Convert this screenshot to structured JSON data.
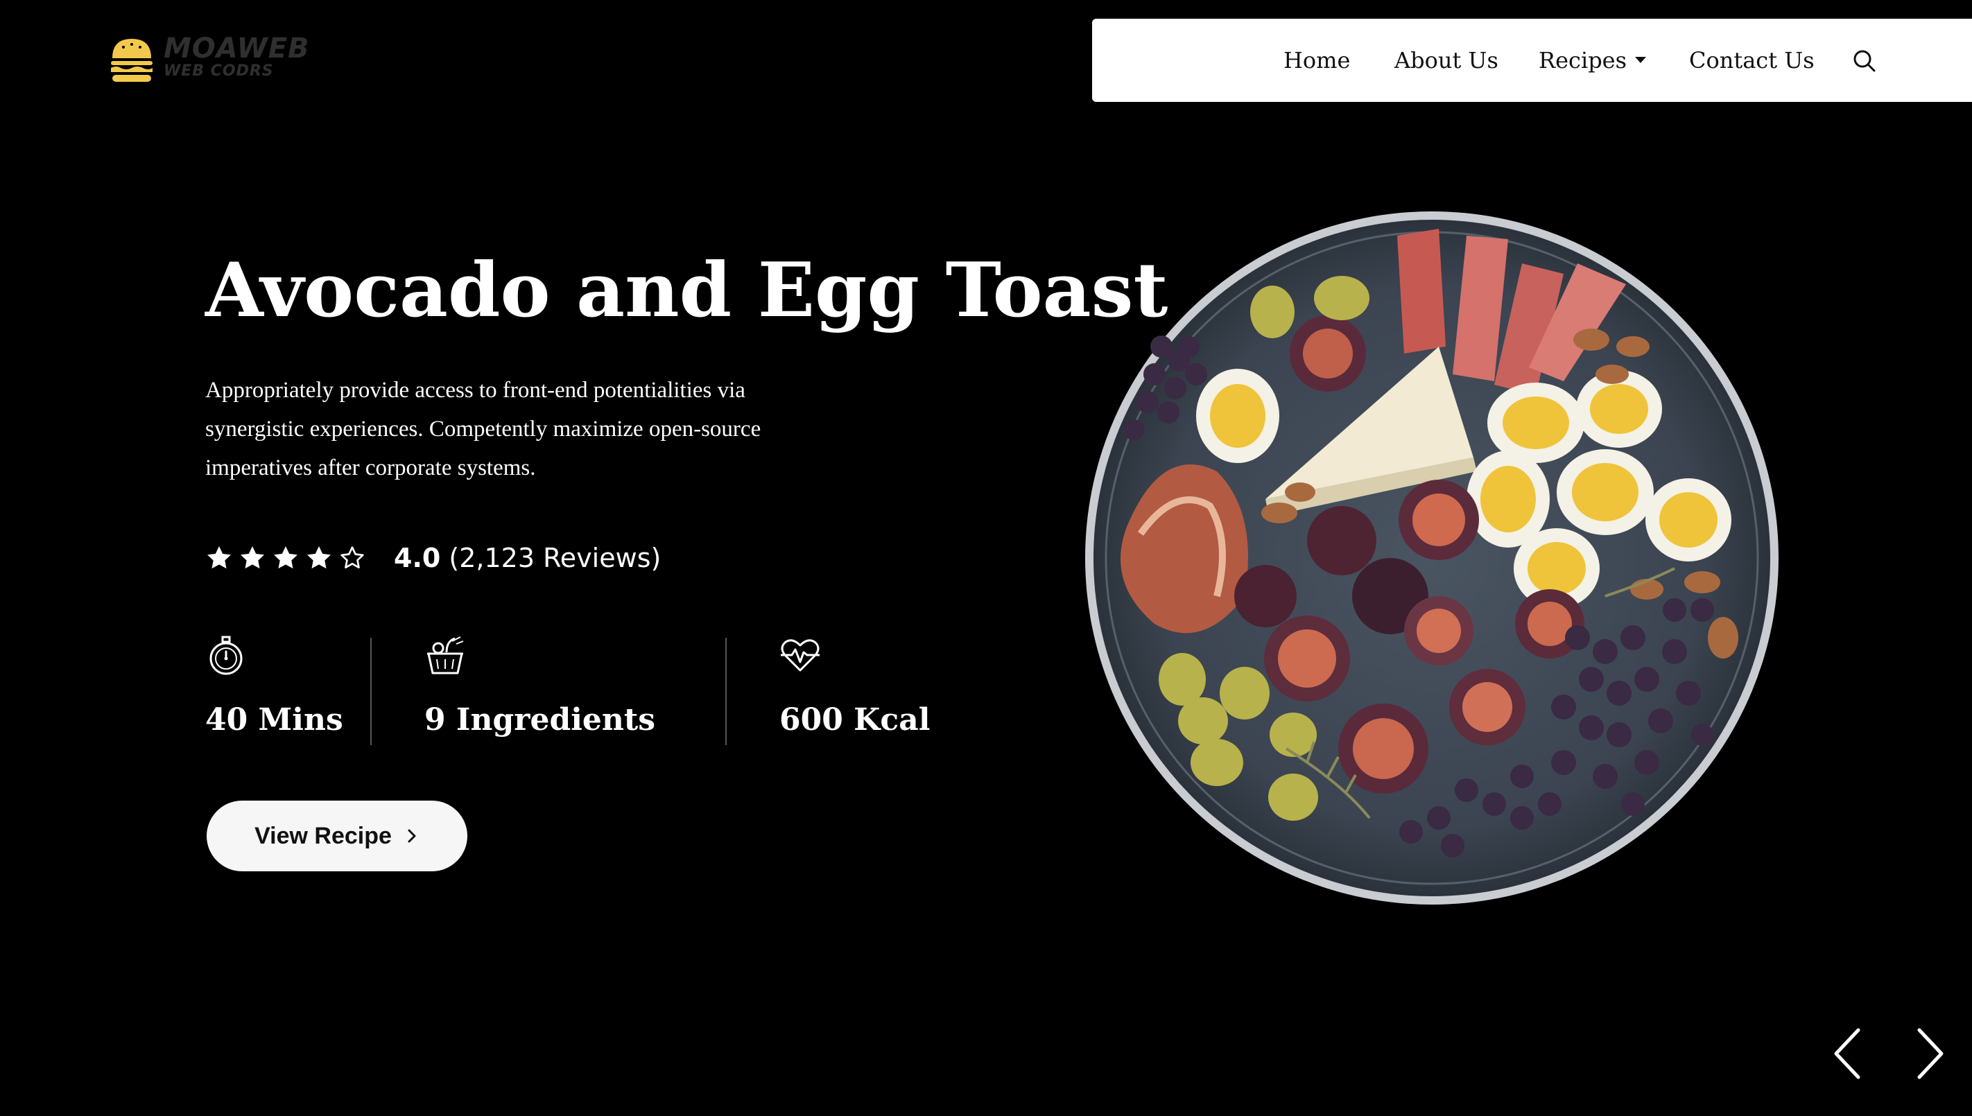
{
  "logo": {
    "line1": "MOAWEB",
    "line2": "WEB CODRS"
  },
  "nav": {
    "items": [
      {
        "label": "Home"
      },
      {
        "label": "About Us"
      },
      {
        "label": "Recipes"
      },
      {
        "label": "Contact Us"
      }
    ],
    "icons": {
      "search": "search-icon",
      "recipes_dropdown": "caret-down-icon"
    }
  },
  "hero": {
    "title": "Avocado and Egg Toast",
    "description": "Appropriately provide access to front-end potentialities via synergistic experiences. Competently maximize open-source imperatives after corporate systems.",
    "rating": {
      "value": "4.0",
      "reviews": "(2,123 Reviews)",
      "stars_filled": 4,
      "stars_total": 5
    },
    "stats": [
      {
        "label": "40 Mins",
        "icon": "stopwatch-icon"
      },
      {
        "label": "9 Ingredients",
        "icon": "basket-icon"
      },
      {
        "label": "600 Kcal",
        "icon": "heartbeat-icon"
      }
    ],
    "button": {
      "label": "View Recipe",
      "icon": "chevron-right-icon"
    }
  },
  "slider": {
    "prev_icon": "chevron-left-icon",
    "next_icon": "chevron-right-icon"
  },
  "colors": {
    "background": "#000000",
    "nav_background": "#ffffff",
    "button_background": "#f6f6f6",
    "logo_accent": "#f2c94c"
  }
}
